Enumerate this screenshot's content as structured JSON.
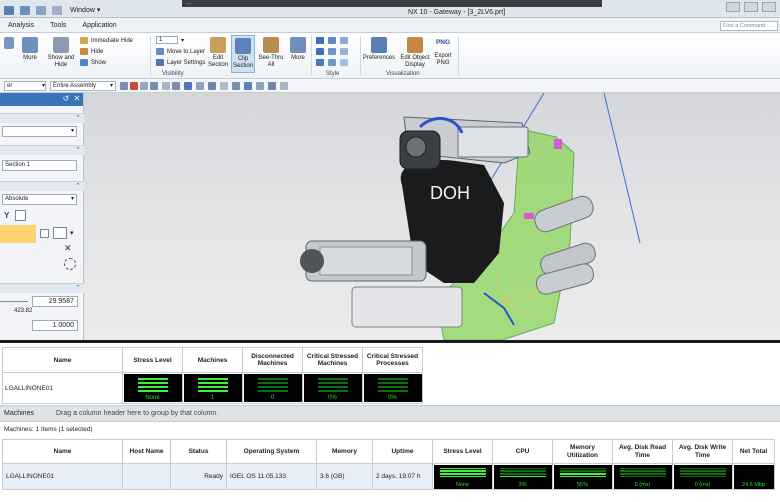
{
  "window": {
    "menu_label": "Window",
    "title": "NX 10 - Gateway - [3_2LV6.prt]",
    "find_command_placeholder": "Find a Command",
    "overlay_text": "…"
  },
  "menubar": [
    "Analysis",
    "Tools",
    "Application"
  ],
  "ribbon": {
    "more1": "More",
    "show_hide": "Show and Hide",
    "immediate_hide": "Immediate Hide",
    "hide": "Hide",
    "show": "Show",
    "layer_value": "1",
    "move_to_layer": "Move to Layer",
    "layer_settings": "Layer Settings",
    "edit_section": "Edit Section",
    "clip_section": "Clip Section",
    "see_thru_all": "See-Thru All",
    "more2": "More",
    "visibility_label": "Visibility",
    "style_label": "Style",
    "preferences": "Preferences",
    "edit_object_display": "Edit Object Display",
    "export_png": "Export PNG",
    "png_tag": "PNG",
    "visualization_label": "Visualization"
  },
  "toolbar": {
    "filter": "er",
    "scope": "Entire Assembly"
  },
  "dialog": {
    "section_name": "Section 1",
    "orient": "Absolute",
    "offset_value": "29.9587",
    "small_value": "423.82",
    "step_value": "1.0000"
  },
  "viewport": {
    "engine_label": "DOH"
  },
  "summary": {
    "headers": [
      "Name",
      "Stress Level",
      "Machines",
      "Disconnected Machines",
      "Critical Stressed Machines",
      "Critical Stressed Processes"
    ],
    "row": {
      "name": "LGALLINONE01",
      "stress_level": "None",
      "machines": "1",
      "disconnected": "0",
      "critical_machines": "0%",
      "critical_processes": "0%"
    }
  },
  "machines": {
    "title": "Machines",
    "group_hint": "Drag a column header here to group by that column.",
    "count_text": "Machines: 1 Items (1 selected)",
    "headers": [
      "Name",
      "Host Name",
      "Status",
      "Operating System",
      "Memory",
      "Uptime",
      "Stress Level",
      "CPU",
      "Memory Utilization",
      "Avg. Disk Read Time",
      "Avg. Disk Write Time",
      "Net Total"
    ],
    "row": {
      "name": "LGALLINONE01",
      "host": "",
      "status": "Ready",
      "os": "IGEL OS 11.05.133",
      "memory": "3.6 (GB)",
      "uptime": "2 days, 19:07 h",
      "stress": "None",
      "cpu": "3%",
      "mem_util": "55%",
      "disk_read": "0 (ms)",
      "disk_write": "0 (ms)",
      "net_total": "24.6 Mbp"
    },
    "levels": {
      "cpu": 0.03,
      "mem_util": 0.55
    }
  },
  "colors": {
    "accent_blue": "#3a74b8",
    "gauge_green": "#3cf03c",
    "highlight_yellow": "#fcd46f"
  }
}
